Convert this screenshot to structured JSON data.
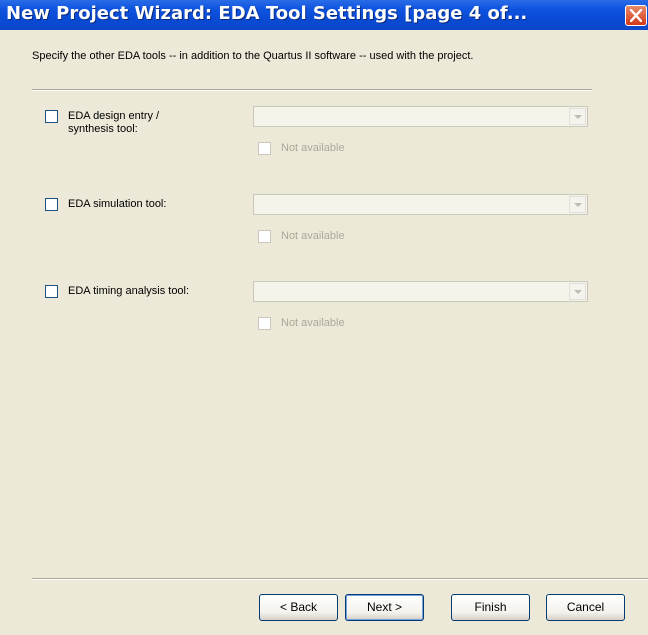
{
  "window": {
    "title": "New Project Wizard: EDA Tool Settings [page 4 of..."
  },
  "instruction": "Specify the other EDA tools -- in addition to the Quartus II software -- used with the project.",
  "tools": [
    {
      "label_line1": "EDA design entry /",
      "label_line2": "synthesis tool:",
      "checked": false,
      "dropdown_value": "",
      "not_available_label": "Not available"
    },
    {
      "label_line1": "EDA simulation tool:",
      "label_line2": "",
      "checked": false,
      "dropdown_value": "",
      "not_available_label": "Not available"
    },
    {
      "label_line1": "EDA timing analysis tool:",
      "label_line2": "",
      "checked": false,
      "dropdown_value": "",
      "not_available_label": "Not available"
    }
  ],
  "buttons": {
    "back": "< Back",
    "next": "Next >",
    "finish": "Finish",
    "cancel": "Cancel"
  },
  "icons": {
    "close": "close-icon",
    "dropdown_arrow": "chevron-down-icon"
  },
  "colors": {
    "titlebar": "#0a4bd6",
    "dialog_bg": "#ece9d8",
    "close_button": "#d4391a",
    "disabled_text": "#aca899"
  }
}
